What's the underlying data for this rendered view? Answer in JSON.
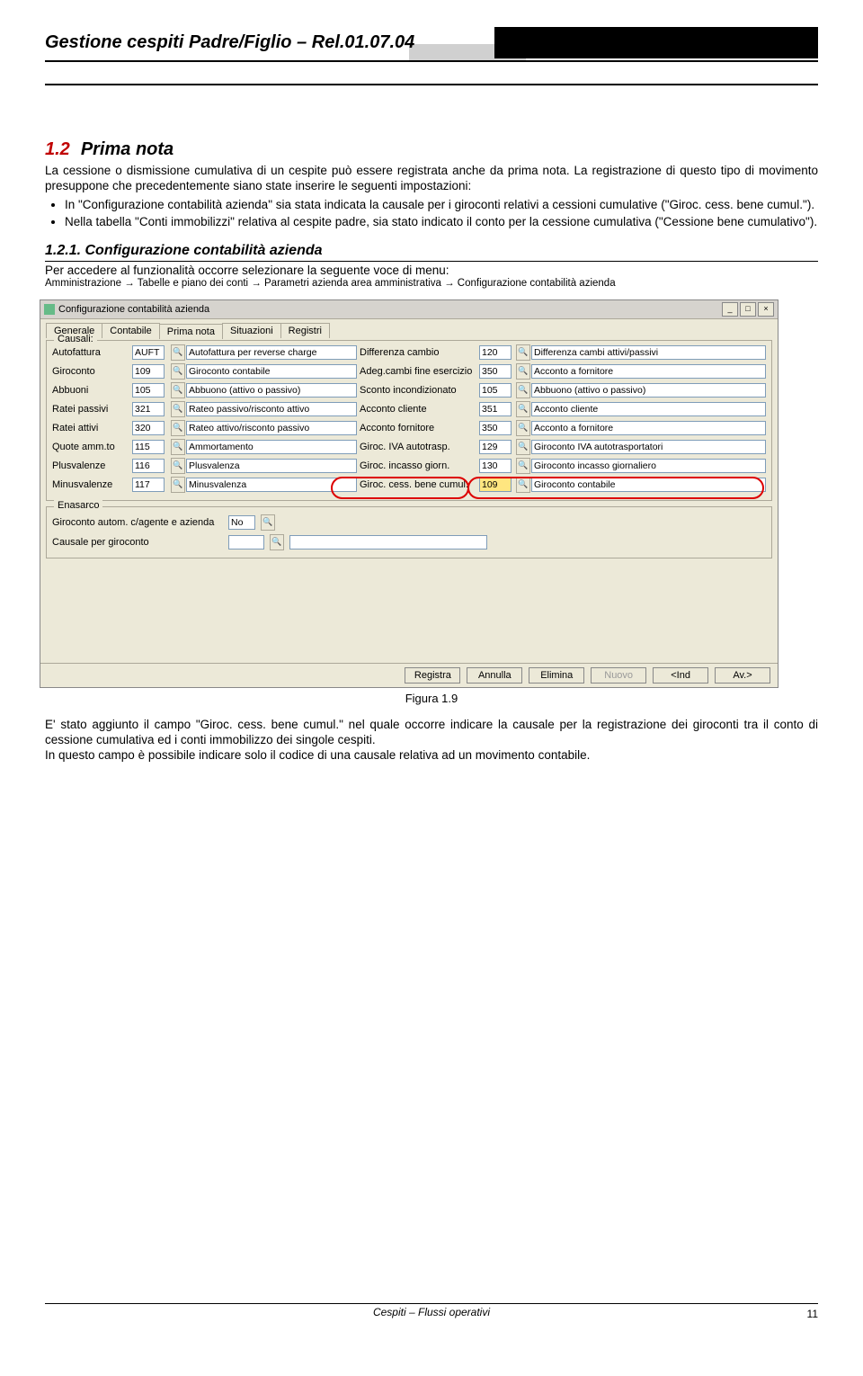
{
  "header": {
    "title": "Gestione cespiti Padre/Figlio – Rel.01.07.04"
  },
  "section": {
    "num": "1.2",
    "title": "Prima nota"
  },
  "para1": "La cessione o dismissione cumulativa di un cespite può essere registrata anche da prima nota. La registrazione di questo tipo di movimento presuppone che precedentemente siano state inserire le seguenti impostazioni:",
  "bullet1": "In \"Configurazione contabilità azienda\" sia stata indicata la causale per i giroconti relativi a cessioni cumulative (\"Giroc. cess. bene cumul.\").",
  "bullet2": "Nella tabella \"Conti immobilizzi\" relativa al cespite padre, sia stato indicato il conto per la cessione cumulativa (\"Cessione bene cumulativo\").",
  "sub": {
    "num": "1.2.1.",
    "title": "Configurazione contabilità azienda"
  },
  "para2": "Per accedere al funzionalità occorre selezionare la seguente voce di menu:",
  "menu": {
    "p1": "Amministrazione",
    "p2": "Tabelle e piano dei conti",
    "p3": "Parametri azienda area amministrativa",
    "p4": "Configurazione contabilità azienda"
  },
  "shot": {
    "title": "Configurazione contabilità azienda",
    "tabs": [
      "Generale",
      "Contabile",
      "Prima nota",
      "Situazioni",
      "Registri"
    ],
    "fieldset1": "Causali:",
    "rows": [
      {
        "l": "Autofattura",
        "c": "AUFT",
        "d": "Autofattura per reverse charge",
        "l2": "Differenza cambio",
        "c2": "120",
        "d2": "Differenza cambi attivi/passivi"
      },
      {
        "l": "Giroconto",
        "c": "109",
        "d": "Giroconto contabile",
        "l2": "Adeg.cambi fine esercizio",
        "c2": "350",
        "d2": "Acconto a fornitore"
      },
      {
        "l": "Abbuoni",
        "c": "105",
        "d": "Abbuono (attivo o passivo)",
        "l2": "Sconto incondizionato",
        "c2": "105",
        "d2": "Abbuono (attivo o passivo)"
      },
      {
        "l": "Ratei passivi",
        "c": "321",
        "d": "Rateo passivo/risconto attivo",
        "l2": "Acconto cliente",
        "c2": "351",
        "d2": "Acconto cliente"
      },
      {
        "l": "Ratei attivi",
        "c": "320",
        "d": "Rateo attivo/risconto passivo",
        "l2": "Acconto fornitore",
        "c2": "350",
        "d2": "Acconto a fornitore"
      },
      {
        "l": "Quote amm.to",
        "c": "115",
        "d": "Ammortamento",
        "l2": "Giroc. IVA autotrasp.",
        "c2": "129",
        "d2": "Giroconto IVA autotrasportatori"
      },
      {
        "l": "Plusvalenze",
        "c": "116",
        "d": "Plusvalenza",
        "l2": "Giroc. incasso giorn.",
        "c2": "130",
        "d2": "Giroconto incasso giornaliero"
      },
      {
        "l": "Minusvalenze",
        "c": "117",
        "d": "Minusvalenza",
        "l2": "Giroc. cess. bene cumul.",
        "c2": "109",
        "d2": "Giroconto contabile"
      }
    ],
    "fieldset2": "Enasarco",
    "en_lbl": "Giroconto autom. c/agente e azienda",
    "en_val": "No",
    "en_lbl2": "Causale per giroconto",
    "buttons": [
      "Registra",
      "Annulla",
      "Elimina",
      "Nuovo",
      "<Ind",
      "Av.>"
    ]
  },
  "fig": "Figura 1.9",
  "para3": "E' stato aggiunto il campo \"Giroc. cess. bene cumul.\" nel quale occorre indicare la causale per la registrazione dei giroconti tra il conto di cessione cumulativa ed i conti immobilizzo dei singole cespiti.",
  "para4": "In questo campo è possibile indicare solo il codice di una causale relativa ad un movimento contabile.",
  "footer": {
    "mid": "Cespiti – Flussi operativi",
    "page": "11"
  }
}
